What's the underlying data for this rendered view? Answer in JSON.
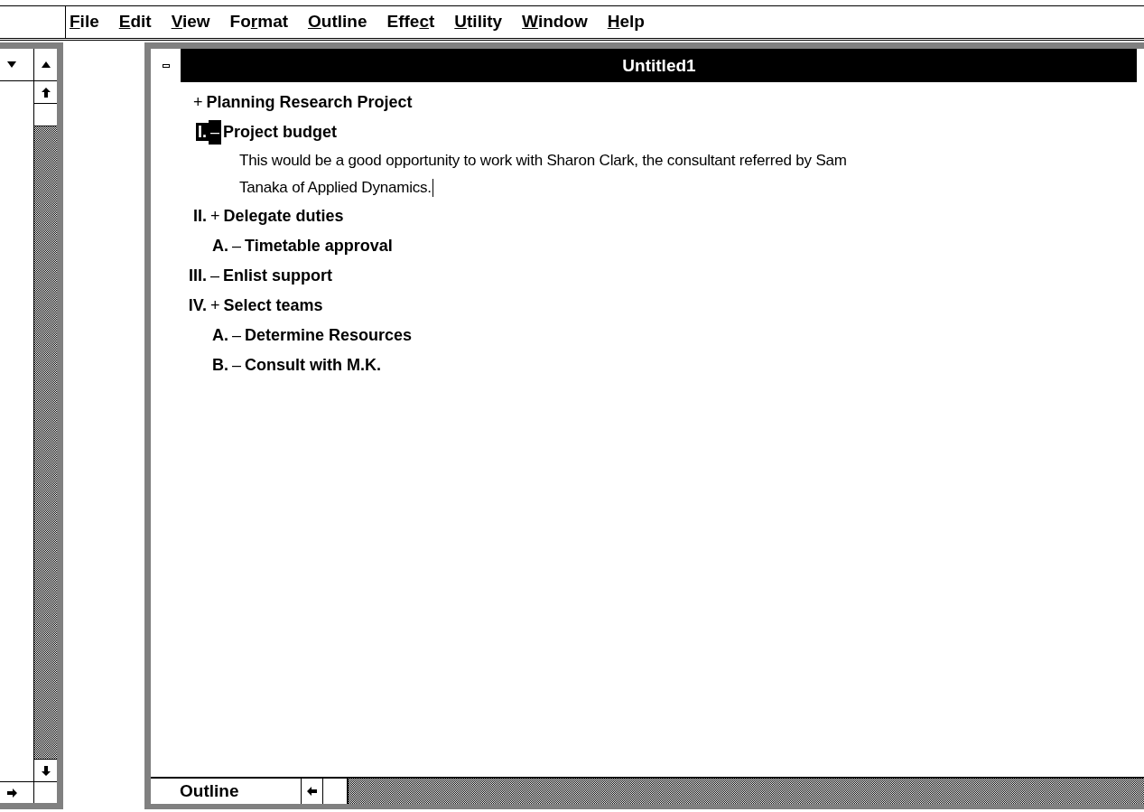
{
  "menu": [
    {
      "key": "F",
      "after": "ile"
    },
    {
      "key": "E",
      "after": "dit"
    },
    {
      "key": "V",
      "after": "iew"
    },
    {
      "before": "Fo",
      "key": "r",
      "after": "mat"
    },
    {
      "key": "O",
      "after": "utline"
    },
    {
      "before": "Effe",
      "key": "c",
      "after": "t"
    },
    {
      "key": "U",
      "after": "tility"
    },
    {
      "key": "W",
      "after": "indow"
    },
    {
      "key": "H",
      "after": "elp"
    }
  ],
  "document": {
    "title": "Untitled1",
    "view_tab": "Outline",
    "outline": [
      {
        "marker": "+",
        "text": "Planning Research Project",
        "selected": false,
        "children": [
          {
            "number": "I.",
            "marker": "–",
            "text": "Project budget",
            "selected": true,
            "note_lines": [
              "This would be a good opportunity to work with Sharon Clark, the consultant referred by Sam",
              "Tanaka of Applied Dynamics."
            ]
          },
          {
            "number": "II.",
            "marker": "+",
            "text": "Delegate duties",
            "selected": false,
            "children": [
              {
                "number": "A.",
                "marker": "–",
                "text": "Timetable approval",
                "selected": false
              }
            ]
          },
          {
            "number": "III.",
            "marker": "–",
            "text": "Enlist support",
            "selected": false
          },
          {
            "number": "IV.",
            "marker": "+",
            "text": "Select teams",
            "selected": false,
            "children": [
              {
                "number": "A.",
                "marker": "–",
                "text": "Determine Resources",
                "selected": false
              },
              {
                "number": "B.",
                "marker": "–",
                "text": "Consult with M.K.",
                "selected": false
              }
            ]
          }
        ]
      }
    ]
  }
}
